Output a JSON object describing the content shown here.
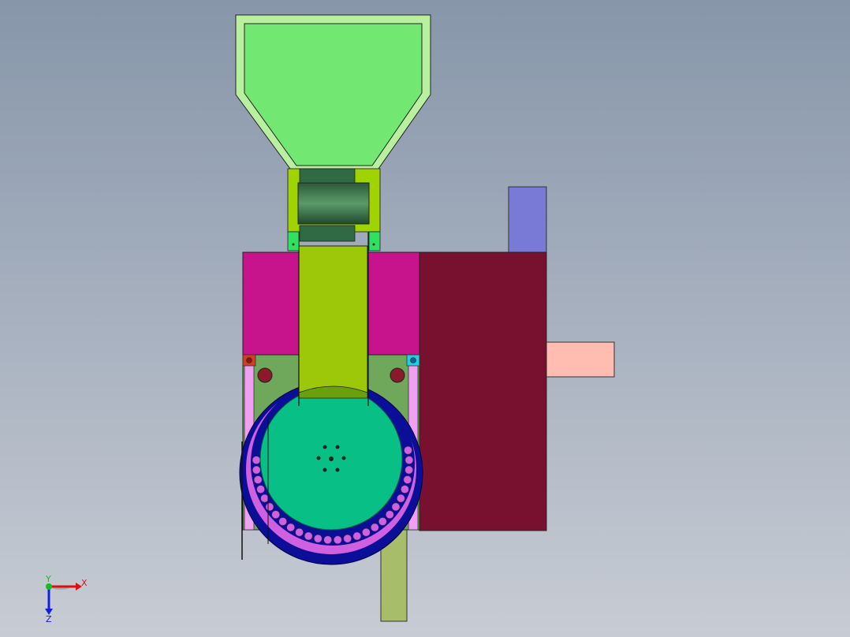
{
  "viewport": {
    "background_top": "#8796aa",
    "background_bottom": "#c7ccd4"
  },
  "model": {
    "parts": [
      {
        "name": "hopper",
        "color": "#72e872"
      },
      {
        "name": "feed-roller",
        "color": "#3d7a4a"
      },
      {
        "name": "chute",
        "color": "#9dc80a"
      },
      {
        "name": "upper-housing",
        "color": "#c8148c"
      },
      {
        "name": "side-housing",
        "color": "#78112f"
      },
      {
        "name": "motor-block",
        "color": "#7979d6"
      },
      {
        "name": "output-shaft",
        "color": "#ffbdb2"
      },
      {
        "name": "crusher-drum",
        "color": "#0b0f98"
      },
      {
        "name": "rotor",
        "color": "#08c086"
      },
      {
        "name": "discharge-spout",
        "color": "#a8bd6a"
      }
    ]
  },
  "triad": {
    "x_label": "X",
    "y_label": "Y",
    "z_label": "Z",
    "x_color": "#e01010",
    "y_color": "#10c020",
    "z_color": "#1020e0"
  }
}
